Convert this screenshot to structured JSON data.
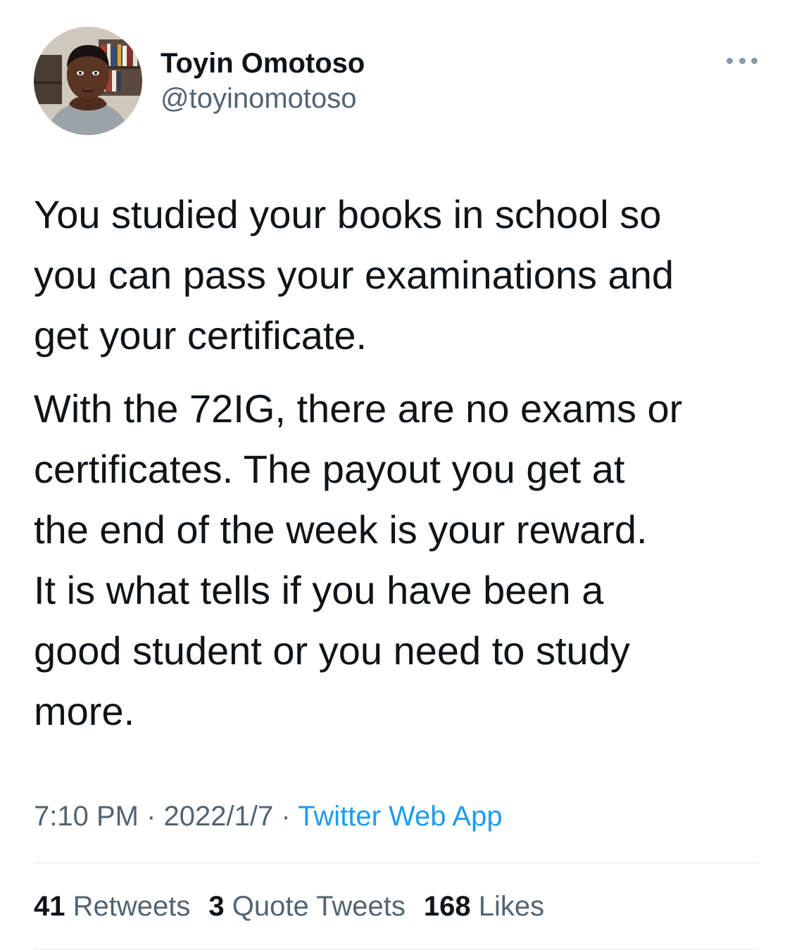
{
  "author": {
    "name": "Toyin Omotoso",
    "handle": "@toyinomotoso",
    "avatar_icon": "profile-photo"
  },
  "tweet": {
    "paragraphs": [
      "You studied your books in school so\nyou can pass your examinations and\nget your certificate.",
      "With the 72IG, there are no exams or\ncertificates. The payout you get at\nthe end of the week is your reward.\nIt is what tells if you have been a\ngood student or you need to study\nmore."
    ]
  },
  "meta": {
    "time": "7:10 PM",
    "separator": "·",
    "date": "2022/1/7",
    "source": "Twitter Web App"
  },
  "stats": {
    "retweets_count": "41",
    "retweets_label": "Retweets",
    "quotes_count": "3",
    "quotes_label": "Quote Tweets",
    "likes_count": "168",
    "likes_label": "Likes"
  },
  "colors": {
    "text": "#0f1419",
    "secondary": "#536471",
    "link": "#1d9bf0",
    "divider": "#e6e8ea"
  },
  "more_icon": "more-horizontal-icon"
}
